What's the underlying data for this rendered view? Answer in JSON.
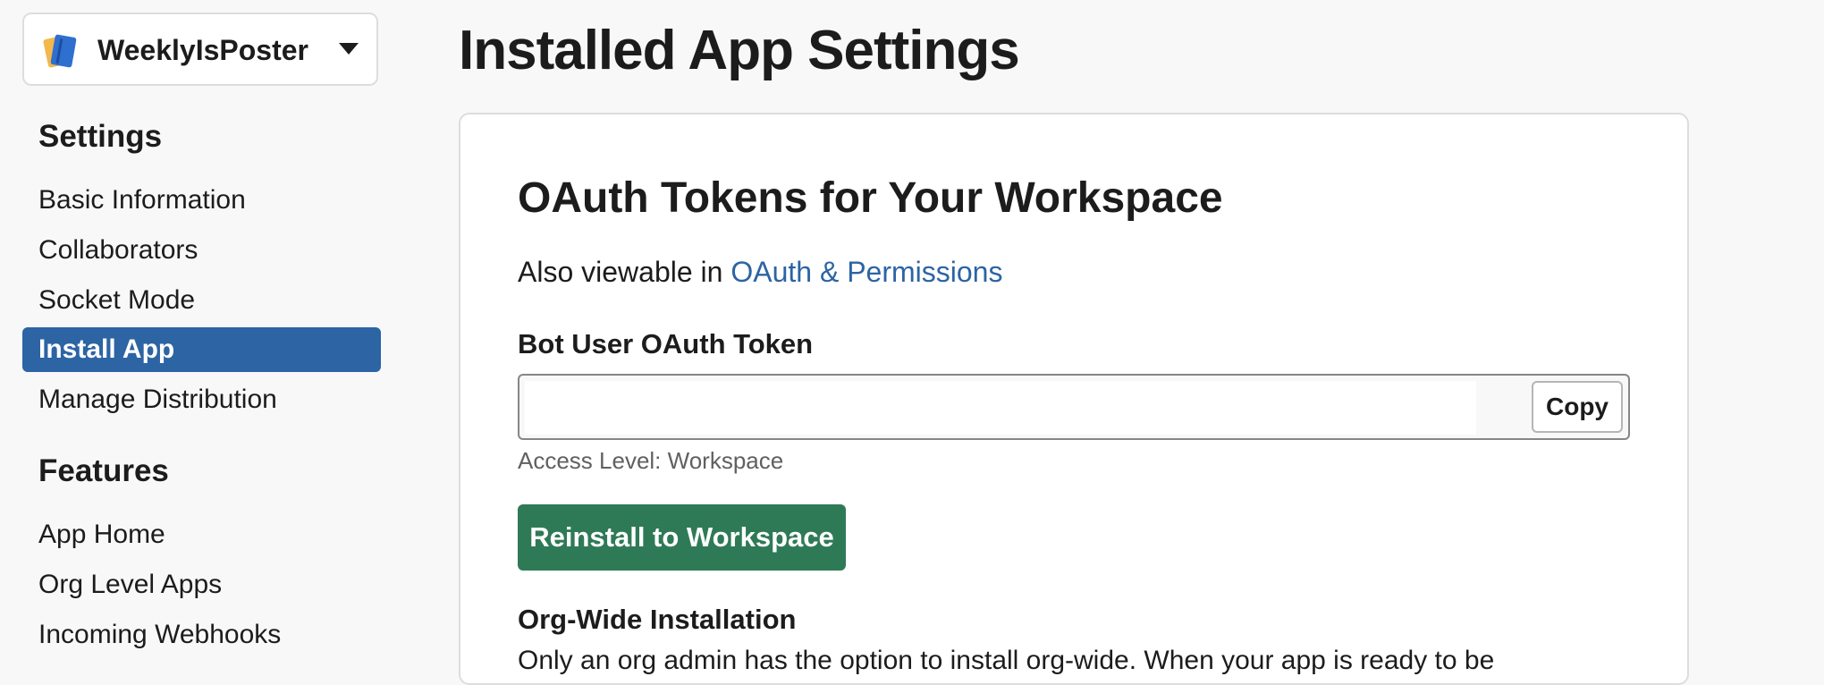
{
  "app_switcher": {
    "app_name": "WeeklyIsPoster",
    "icon": "notebook-icon"
  },
  "sidebar": {
    "settings_heading": "Settings",
    "settings_items": [
      {
        "label": "Basic Information",
        "active": false
      },
      {
        "label": "Collaborators",
        "active": false
      },
      {
        "label": "Socket Mode",
        "active": false
      },
      {
        "label": "Install App",
        "active": true
      },
      {
        "label": "Manage Distribution",
        "active": false
      }
    ],
    "features_heading": "Features",
    "features_items": [
      {
        "label": "App Home"
      },
      {
        "label": "Org Level Apps"
      },
      {
        "label": "Incoming Webhooks"
      }
    ],
    "active_color": "#2c64a4"
  },
  "main": {
    "page_title": "Installed App Settings",
    "card": {
      "title": "OAuth Tokens for Your Workspace",
      "also_viewable_prefix": "Also viewable in ",
      "also_viewable_link": "OAuth & Permissions",
      "token_label": "Bot User OAuth Token",
      "token_value": "",
      "copy_label": "Copy",
      "access_level": "Access Level: Workspace",
      "reinstall_label": "Reinstall to Workspace",
      "reinstall_color": "#2f7a56",
      "org_wide_label": "Org-Wide Installation",
      "org_wide_description": "Only an org admin has the option to install org-wide. When your app is ready to be"
    }
  }
}
